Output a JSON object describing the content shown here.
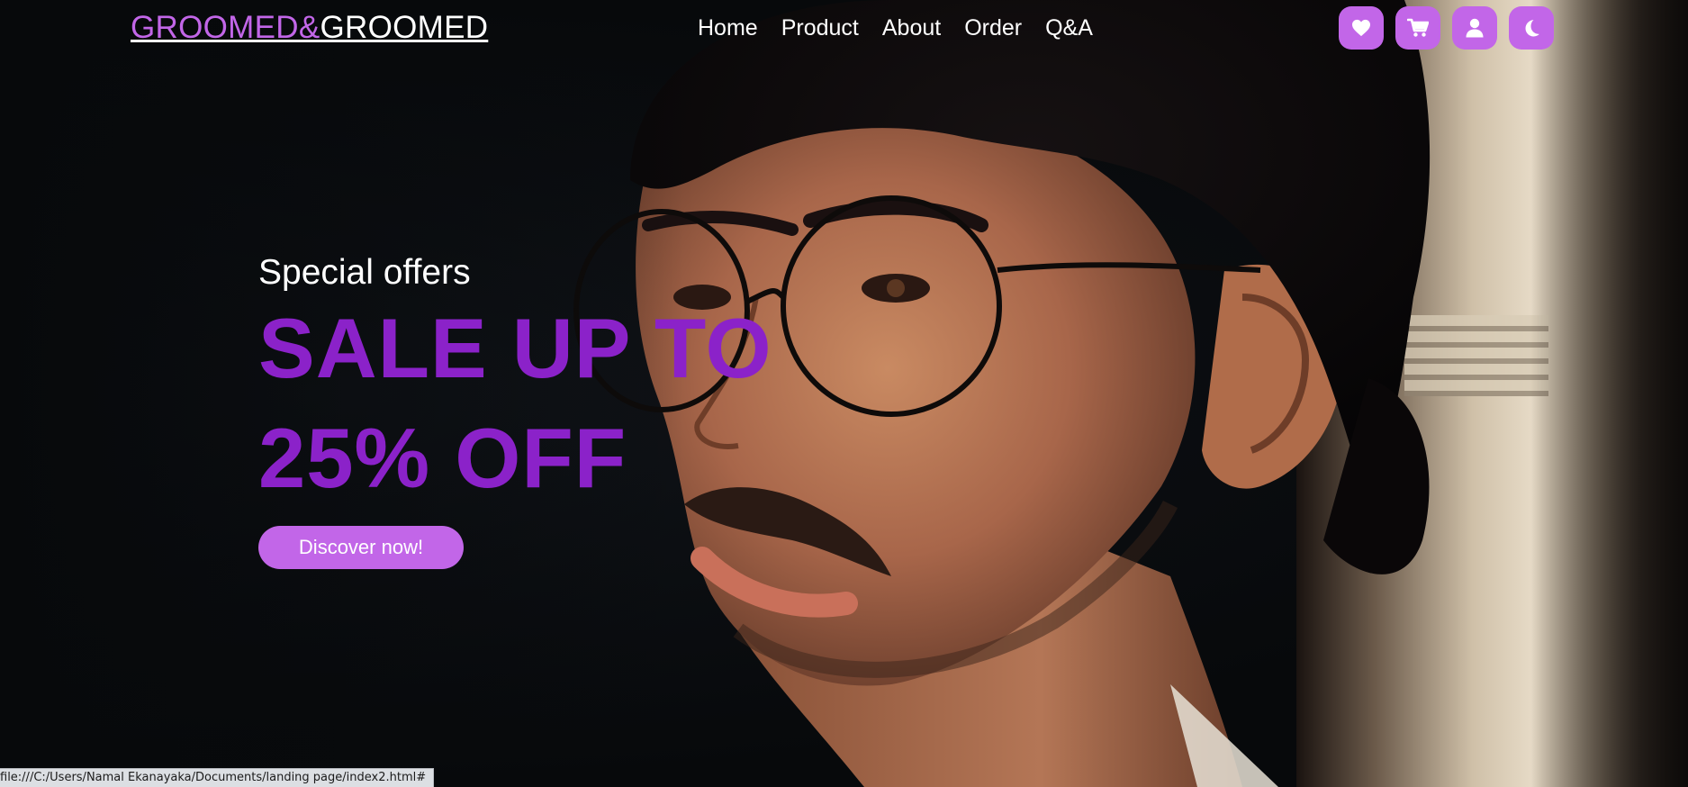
{
  "brand": {
    "logo_part1": "GROOMED&",
    "logo_part2": "GROOMED",
    "accent_color": "#c266e8",
    "headline_color": "#8b22c9"
  },
  "nav": {
    "links": [
      "Home",
      "Product",
      "About",
      "Order",
      "Q&A"
    ],
    "icons": [
      "heart-icon",
      "cart-icon",
      "user-icon",
      "moon-icon"
    ]
  },
  "hero": {
    "eyebrow": "Special offers",
    "headline_line1": "SALE UP TO",
    "headline_line2": "25% OFF",
    "cta_label": "Discover now!"
  },
  "status_bar": {
    "url": "file:///C:/Users/Namal Ekanayaka/Documents/landing page/index2.html#"
  }
}
